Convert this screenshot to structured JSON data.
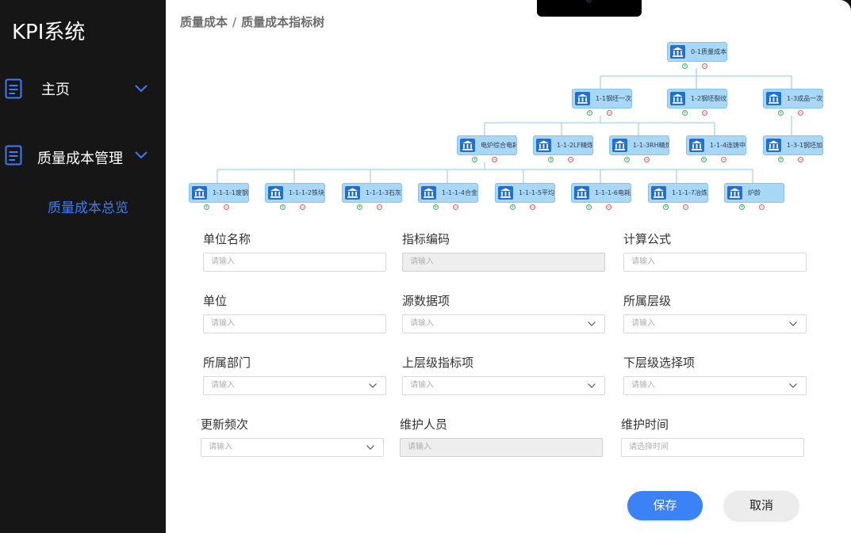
{
  "app": {
    "title": "KPI系统"
  },
  "sidebar": {
    "items": [
      {
        "label": "主页",
        "icon": "document-icon"
      },
      {
        "label": "质量成本管理",
        "icon": "document-icon"
      }
    ],
    "sub_item": "质量成本总览"
  },
  "breadcrumb": {
    "root": "质量成本",
    "sep": "/",
    "current": "质量成本指标树"
  },
  "tree": {
    "node_icon": "bank-icon",
    "nodes": [
      {
        "id": "n0",
        "label": "0-1质量成本"
      },
      {
        "id": "n11",
        "label": "1-1钢坯一次合格率"
      },
      {
        "id": "n12",
        "label": "1-2钢坯裂纹发生率"
      },
      {
        "id": "n13",
        "label": "1-3成品一次合格率"
      },
      {
        "id": "n111",
        "label": "电炉综合电耗"
      },
      {
        "id": "n112",
        "label": "1-1-2LF精炼温度合"
      },
      {
        "id": "n113",
        "label": "1-1-3RH精炼温度合"
      },
      {
        "id": "n114",
        "label": "1-1-4连铸中包过热"
      },
      {
        "id": "n131",
        "label": "1-3-1钢坯加热"
      },
      {
        "id": "n1111",
        "label": "1-1-1-1废钢消耗"
      },
      {
        "id": "n1112",
        "label": "1-1-1-2铁块消耗"
      },
      {
        "id": "n1113",
        "label": "1-1-1-3石灰消耗"
      },
      {
        "id": "n1114",
        "label": "1-1-1-4合金料消耗"
      },
      {
        "id": "n1115",
        "label": "1-1-1-5平均出钢温度"
      },
      {
        "id": "n1116",
        "label": "1-1-1-6电耗"
      },
      {
        "id": "n1117",
        "label": "1-1-1-7冶炼炉数"
      },
      {
        "id": "n1118",
        "label": "炉龄"
      }
    ]
  },
  "form": {
    "fields": [
      {
        "label": "单位名称",
        "placeholder": "请输入",
        "disabled": false,
        "dropdown": false
      },
      {
        "label": "指标编码",
        "placeholder": "请输入",
        "disabled": true,
        "dropdown": false
      },
      {
        "label": "计算公式",
        "placeholder": "请输入",
        "disabled": false,
        "dropdown": false
      },
      {
        "label": "单位",
        "placeholder": "请输入",
        "disabled": false,
        "dropdown": false
      },
      {
        "label": "源数据项",
        "placeholder": "请输入",
        "disabled": false,
        "dropdown": true
      },
      {
        "label": "所属层级",
        "placeholder": "请输入",
        "disabled": false,
        "dropdown": true
      },
      {
        "label": "所属部门",
        "placeholder": "请输入",
        "disabled": false,
        "dropdown": true
      },
      {
        "label": "上层级指标项",
        "placeholder": "请输入",
        "disabled": false,
        "dropdown": true
      },
      {
        "label": "下层级选择项",
        "placeholder": "请输入",
        "disabled": false,
        "dropdown": true
      },
      {
        "label": "更新频次",
        "placeholder": "请输入",
        "disabled": false,
        "dropdown": true
      },
      {
        "label": "维护人员",
        "placeholder": "请输入",
        "disabled": true,
        "dropdown": false
      },
      {
        "label": "维护时间",
        "placeholder": "请选择时间",
        "disabled": false,
        "dropdown": false
      }
    ]
  },
  "buttons": {
    "save": "保存",
    "cancel": "取消"
  },
  "colors": {
    "accent": "#3b82f6",
    "node_fill": "#a9d8f7",
    "link": "#8ccaf2",
    "sidebar_bg": "#161616"
  }
}
